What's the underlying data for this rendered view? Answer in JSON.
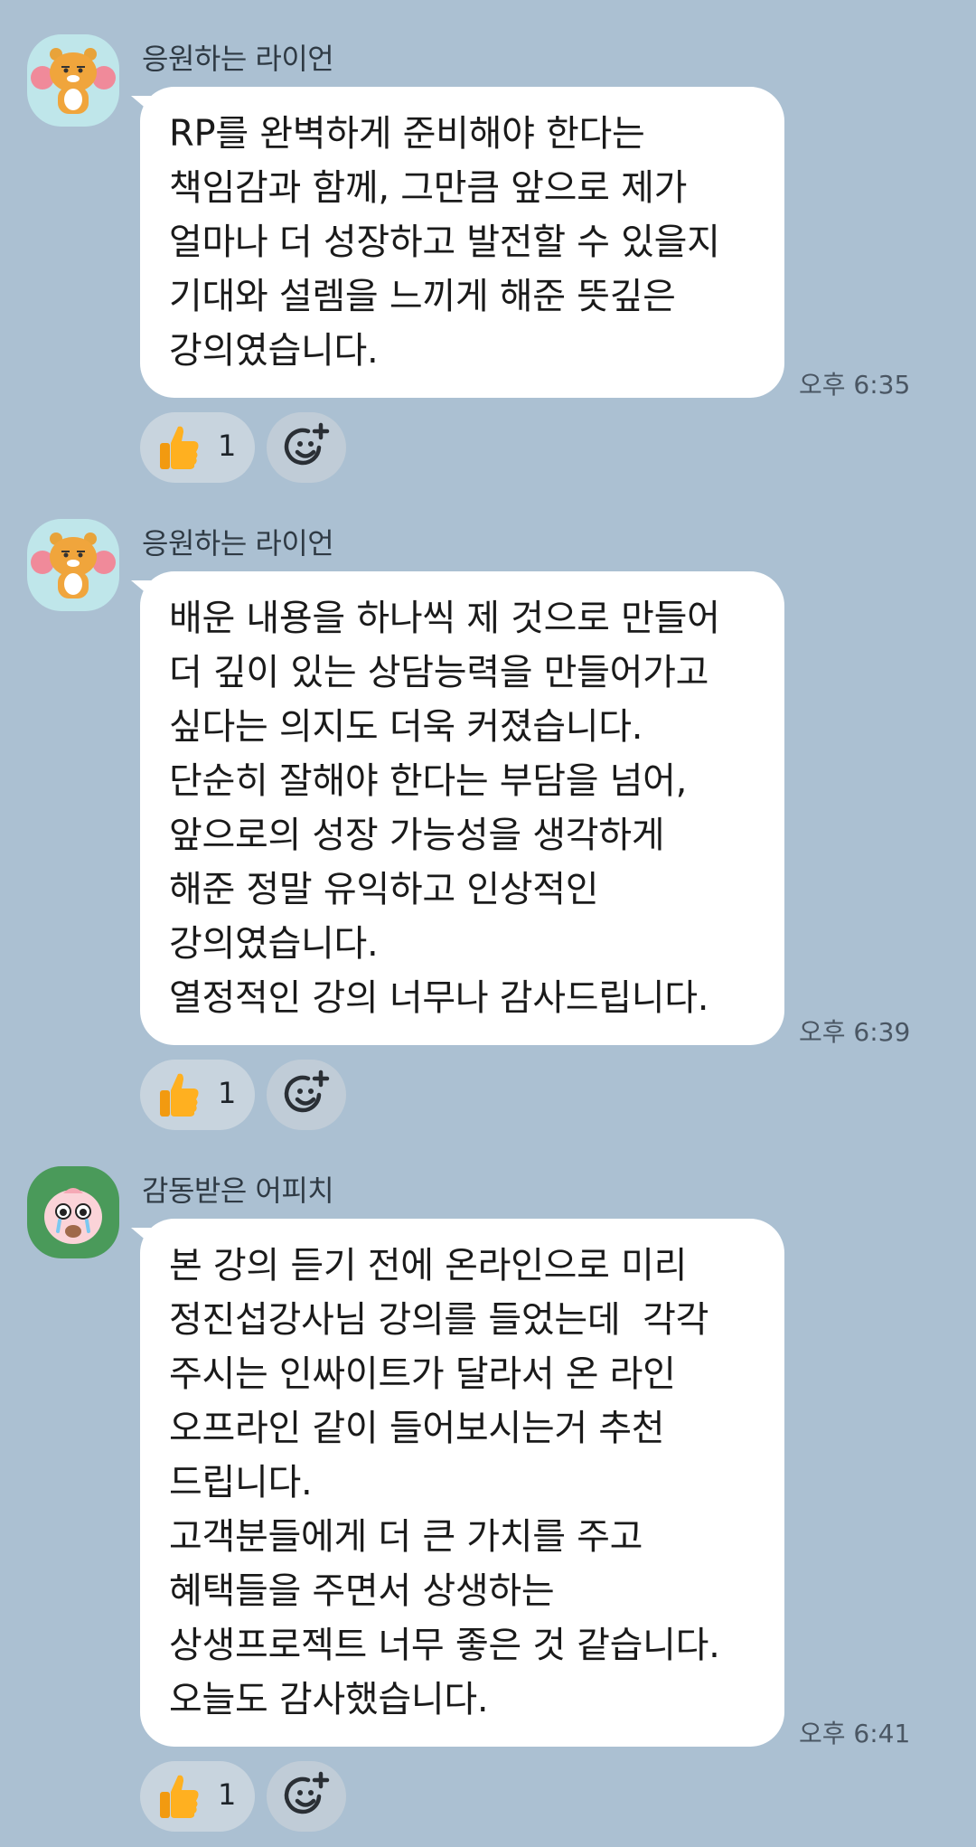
{
  "messages": [
    {
      "sender": "응원하는 라이언",
      "avatar_icon": "ryan-cheering-avatar",
      "lines": [
        "RP를 완벽하게 준비해야 한다는",
        "책임감과 함께, 그만큼 앞으로 제가",
        "얼마나 더 성장하고 발전할 수 있을지",
        "기대와 설렘을 느끼게 해준 뜻깊은",
        "강의였습니다."
      ],
      "time": "오후 6:35",
      "reaction_count": "1"
    },
    {
      "sender": "응원하는 라이언",
      "avatar_icon": "ryan-cheering-avatar",
      "lines": [
        "배운 내용을 하나씩 제 것으로 만들어",
        "더 깊이 있는 상담능력을 만들어가고",
        "싶다는 의지도 더욱 커졌습니다.",
        "단순히 잘해야 한다는 부담을 넘어,",
        "앞으로의 성장 가능성을 생각하게",
        "해준 정말 유익하고 인상적인",
        "강의였습니다.",
        "열정적인 강의 너무나 감사드립니다."
      ],
      "time": "오후 6:39",
      "reaction_count": "1"
    },
    {
      "sender": "감동받은 어피치",
      "avatar_icon": "apeach-touched-avatar",
      "lines": [
        "본 강의 듣기 전에 온라인으로 미리",
        "정진섭강사님 강의를 들었는데  각각",
        "주시는 인싸이트가 달라서 온 라인",
        "오프라인 같이 들어보시는거 추천",
        "드립니다.",
        "고객분들에게 더 큰 가치를 주고",
        "혜택들을 주면서 상생하는",
        "상생프로젝트 너무 좋은 것 같습니다.",
        "오늘도 감사했습니다."
      ],
      "time": "오후 6:41",
      "reaction_count": "1"
    }
  ],
  "icons": {
    "reaction": "thumbs-up-icon",
    "add_reaction": "add-emoji-reaction-icon"
  },
  "colors": {
    "background": "#abc0d2",
    "bubble": "#ffffff",
    "reaction_chip": "#c8d4de",
    "ryan_avatar_bg": "#bfe6ea",
    "apeach_avatar_bg": "#4a9a5a"
  }
}
